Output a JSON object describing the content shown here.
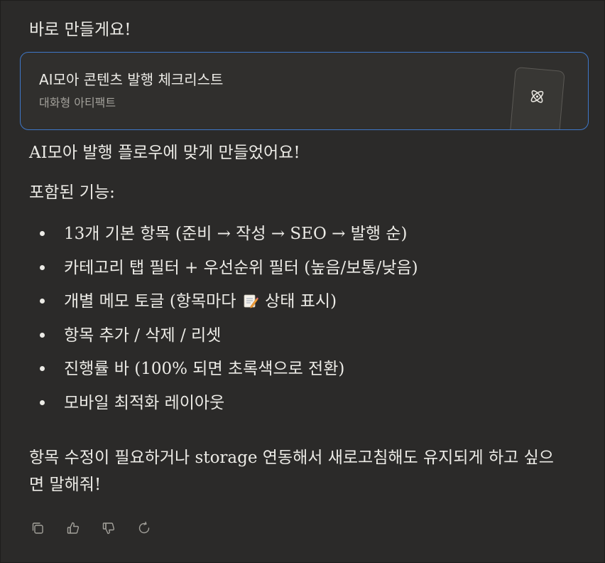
{
  "message": {
    "intro": "바로 만들게요!",
    "artifact": {
      "title": "AI모아 콘텐츠 발행 체크리스트",
      "subtitle": "대화형 아티팩트",
      "icon": "atom-icon"
    },
    "summary": "AI모아 발행 플로우에 맞게 만들었어요!",
    "features_heading": "포함된 기능:",
    "features": [
      "13개 기본 항목 (준비 → 작성 → SEO → 발행 순)",
      "카테고리 탭 필터 + 우선순위 필터 (높음/보통/낮음)",
      {
        "before": "개별 메모 토글 (항목마다",
        "emoji": "memo-icon",
        "after": "상태 표시)"
      },
      "항목 추가 / 삭제 / 리셋",
      "진행률 바 (100% 되면 초록색으로 전환)",
      "모바일 최적화 레이아웃"
    ],
    "closing": "항목 수정이 필요하거나 storage 연동해서 새로고침해도 유지되게 하고 싶으면 말해줘!"
  },
  "actions": [
    "copy-icon",
    "thumbs-up-icon",
    "thumbs-down-icon",
    "retry-icon"
  ],
  "colors": {
    "background": "#2b2a29",
    "text": "#ecebe6",
    "card_border": "#3f78c9",
    "muted": "#a3a19b"
  }
}
